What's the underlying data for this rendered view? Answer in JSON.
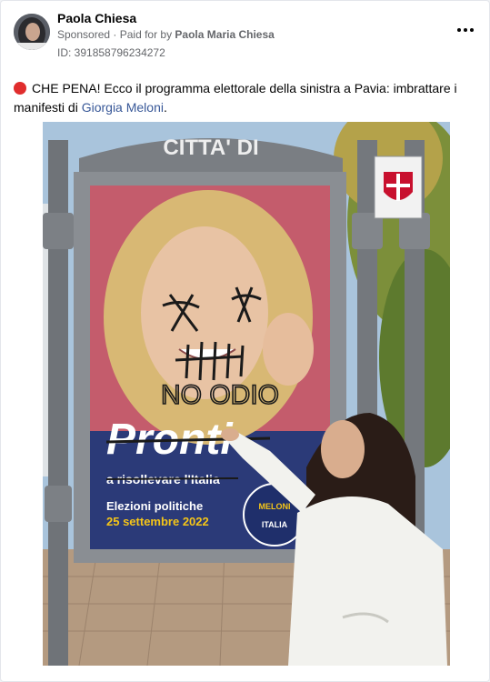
{
  "post": {
    "author_name": "Paola Chiesa",
    "sponsored_label": "Sponsored",
    "separator": " · ",
    "paid_for_prefix": "Paid for by ",
    "paid_for_name": "Paola Maria Chiesa",
    "ad_id": "ID: 391858796234272",
    "more_icon": "more-horizontal-icon",
    "caption_before_link": "CHE PENA! Ecco il programma elettorale della sinistra a Pavia: imbrattare i manifesti di ",
    "caption_link": "Giorgia Meloni",
    "caption_after_link": ".",
    "status_icon": "red-circle-icon"
  },
  "photo": {
    "sign_header": "CITTA' DI",
    "poster_brand": "Pronti",
    "poster_tagline": "a risollevare l'Italia",
    "poster_event": "Elezioni politiche",
    "poster_date": "25 settembre 2022",
    "graffiti_text": "NO ODIO",
    "party_logo_top": "MELONI",
    "party_logo_bottom": "ITALIA"
  },
  "colors": {
    "link": "#385898",
    "muted": "#65676b",
    "status_dot": "#e02d2d",
    "poster_navy": "#1f2f6b",
    "poster_date_yellow": "#f5c518"
  }
}
